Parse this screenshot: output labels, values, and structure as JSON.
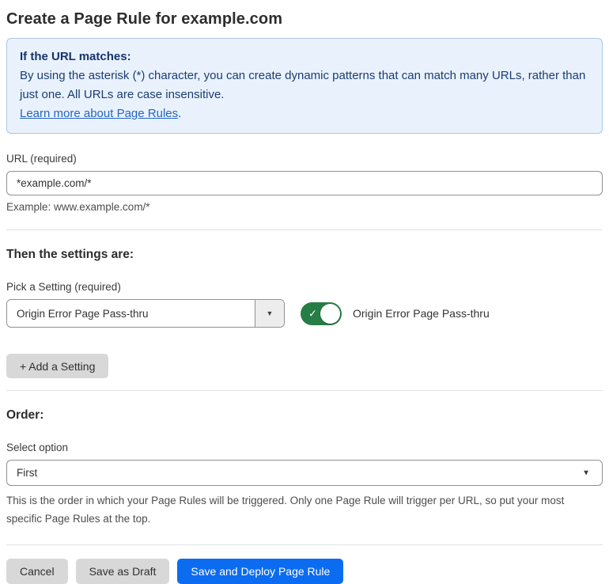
{
  "page": {
    "title": "Create a Page Rule for example.com"
  },
  "info_box": {
    "heading": "If the URL matches:",
    "body": "By using the asterisk (*) character, you can create dynamic patterns that can match many URLs, rather than just one. All URLs are case insensitive.",
    "link_label": "Learn more about Page Rules",
    "link_suffix": "."
  },
  "url_field": {
    "label": "URL (required)",
    "value": "*example.com/*",
    "example": "Example: www.example.com/*"
  },
  "settings": {
    "heading": "Then the settings are:",
    "pick_label": "Pick a Setting (required)",
    "selected_setting": "Origin Error Page Pass-thru",
    "toggle_state": "on",
    "toggle_label": "Origin Error Page Pass-thru",
    "add_button_label": "+ Add a Setting"
  },
  "order": {
    "heading": "Order:",
    "select_label": "Select option",
    "selected_option": "First",
    "help": "This is the order in which your Page Rules will be triggered. Only one Page Rule will trigger per URL, so put your most specific Page Rules at the top."
  },
  "footer": {
    "cancel_label": "Cancel",
    "save_draft_label": "Save as Draft",
    "save_deploy_label": "Save and Deploy Page Rule"
  },
  "icons": {
    "check": "✓",
    "dropdown_arrow": "▼"
  },
  "colors": {
    "accent_blue": "#0b6cf1",
    "toggle_green": "#267d46",
    "info_background": "#e9f2fc",
    "info_border": "#abc6e6",
    "info_text": "#1b3c74",
    "link_blue": "#2565c0",
    "button_gray": "#d8d8d8",
    "divider": "#e2e2e2"
  }
}
